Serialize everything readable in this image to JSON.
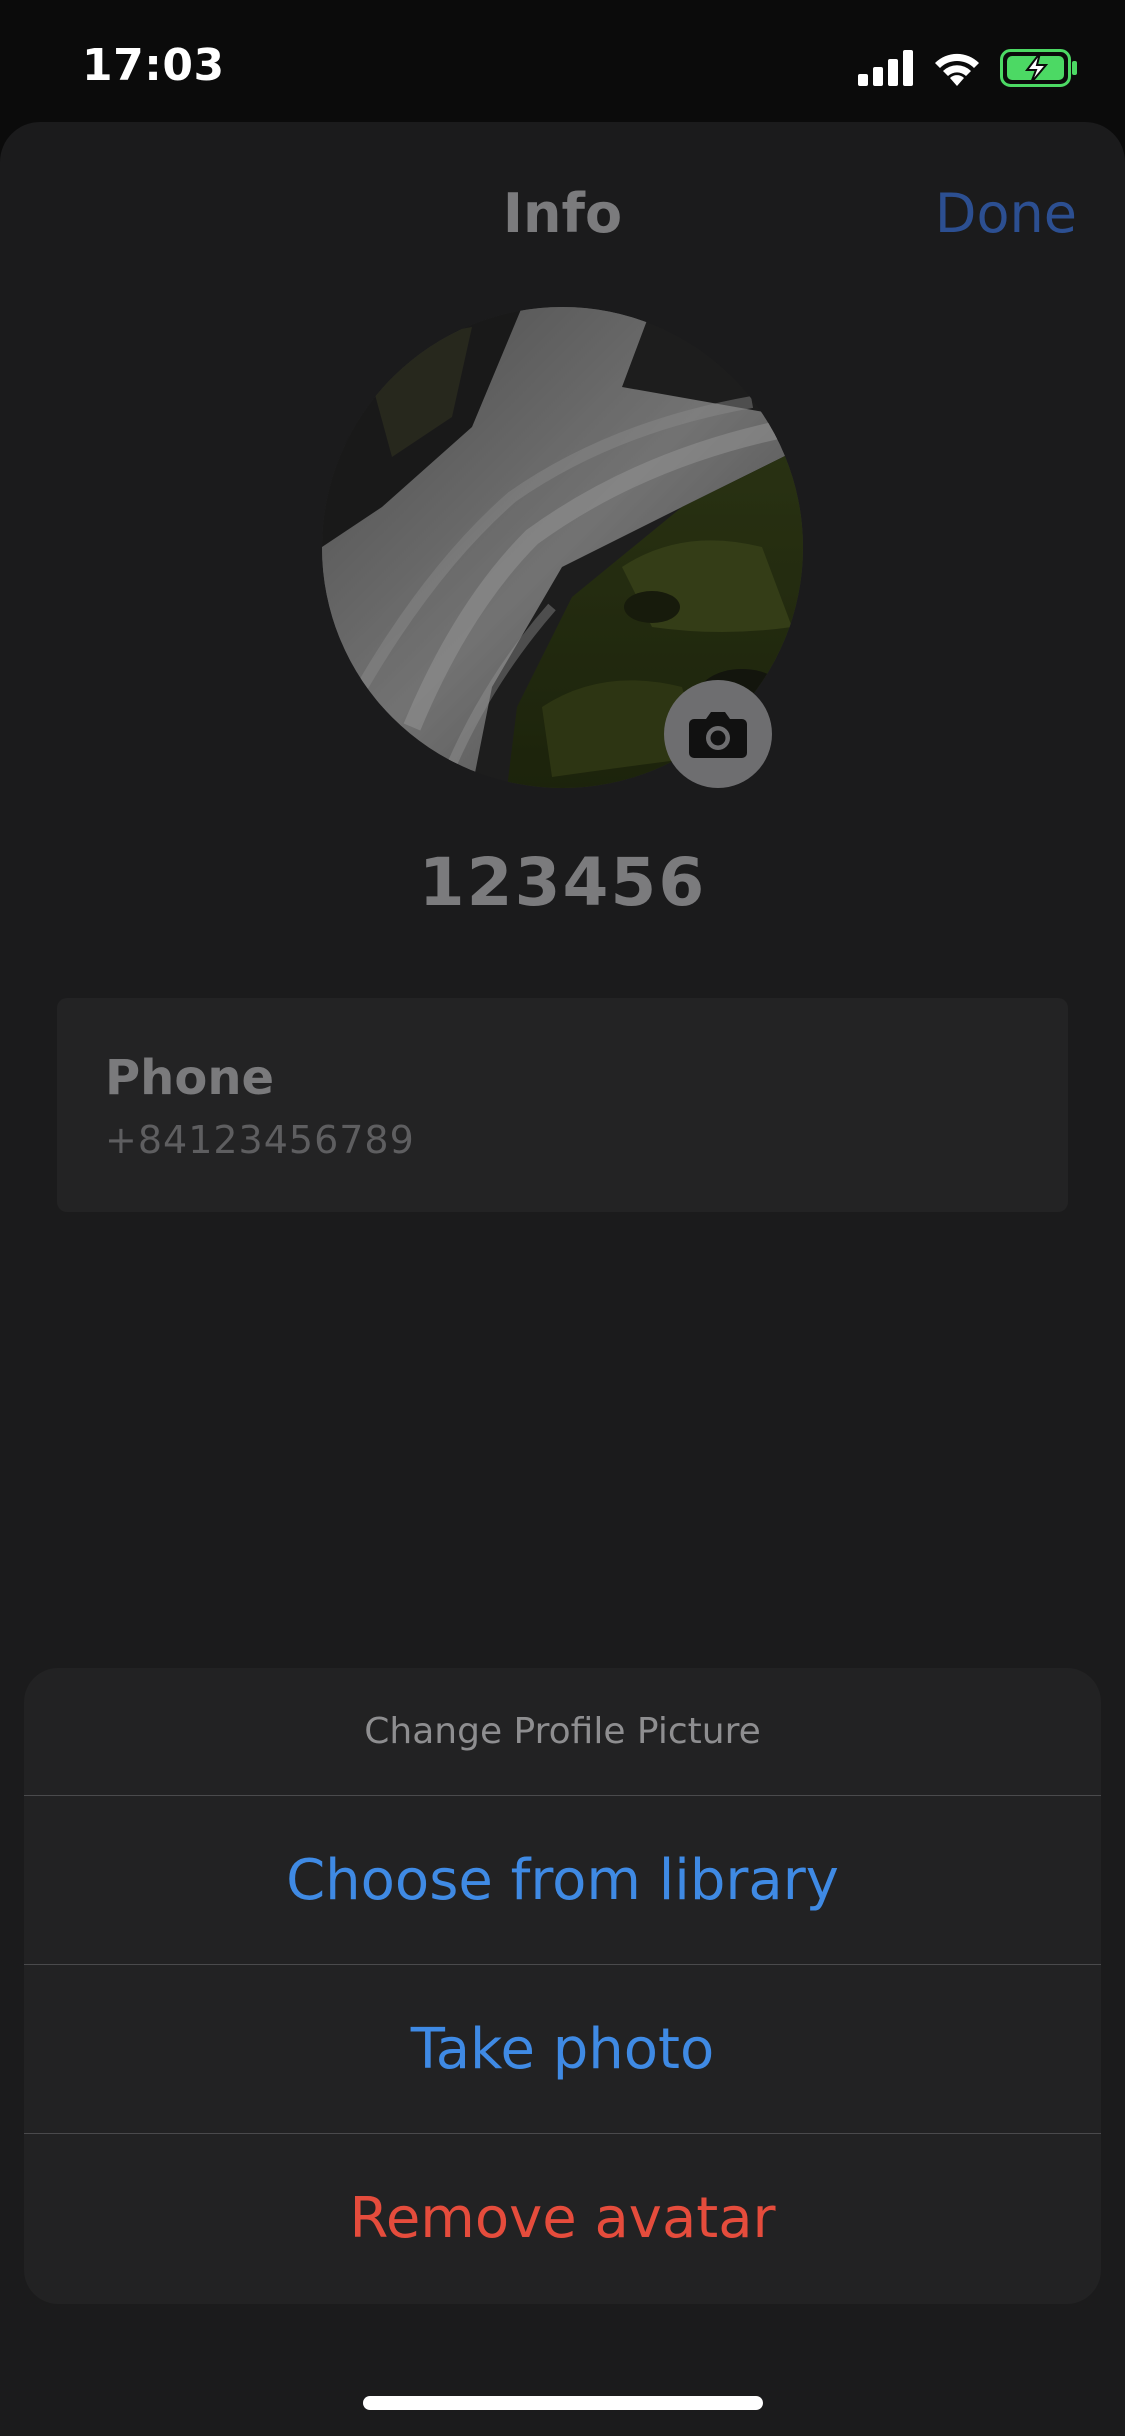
{
  "status_bar": {
    "time": "17:03"
  },
  "header": {
    "title": "Info",
    "done_label": "Done"
  },
  "profile": {
    "username": "123456",
    "phone_label": "Phone",
    "phone_value": "+84123456789"
  },
  "action_sheet": {
    "title": "Change Profile Picture",
    "items": [
      {
        "label": "Choose from library"
      },
      {
        "label": "Take photo"
      },
      {
        "label": "Remove avatar"
      }
    ]
  },
  "colors": {
    "accent": "#3f8ae4",
    "destructive": "#e54c3c",
    "battery_charging": "#4cd964"
  },
  "icons": [
    "cellular-signal-icon",
    "wifi-icon",
    "battery-charging-icon",
    "camera-icon"
  ]
}
